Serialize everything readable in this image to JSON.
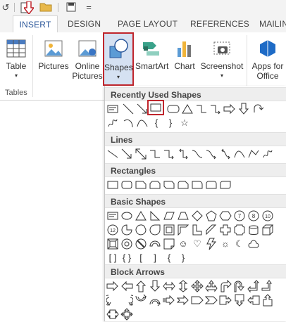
{
  "tabs": [
    {
      "label": "INSERT",
      "active": true
    },
    {
      "label": "DESIGN"
    },
    {
      "label": "PAGE LAYOUT"
    },
    {
      "label": "REFERENCES"
    },
    {
      "label": "MAILIN"
    }
  ],
  "ribbon": {
    "table_label": "Table",
    "pictures_label": "Pictures",
    "online_pictures_line1": "Online",
    "online_pictures_line2": "Pictures",
    "shapes_label": "Shapes",
    "smartart_label": "SmartArt",
    "chart_label": "Chart",
    "screenshot_label": "Screenshot",
    "apps_line1": "Apps for",
    "apps_line2": "Office",
    "tables_group_label": "Tables"
  },
  "dropdown": {
    "recently_used": "Recently Used Shapes",
    "lines": "Lines",
    "rectangles": "Rectangles",
    "basic_shapes": "Basic Shapes",
    "block_arrows": "Block Arrows",
    "basic_digits": [
      "7",
      "8",
      "10",
      "12"
    ]
  },
  "colors": {
    "accent_blue": "#2b579a",
    "highlight_red": "#c0252c",
    "ribbon_bg": "#ffffff",
    "tab_bar_bg": "#f3f3f3",
    "section_header_bg": "#eeeeee"
  }
}
